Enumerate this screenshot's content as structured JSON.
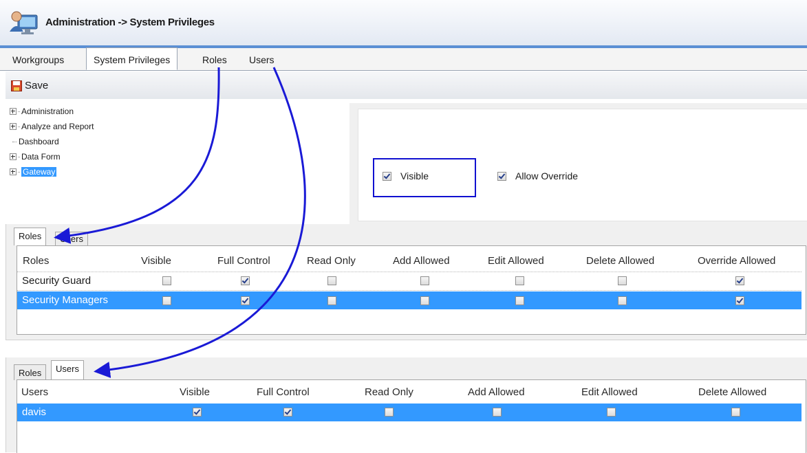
{
  "window": {
    "title": "Administration -> System Privileges"
  },
  "top_tabs": [
    "Workgroups",
    "System Privileges",
    "Roles",
    "Users"
  ],
  "top_tabs_active": "System Privileges",
  "toolbar": {
    "save_label": "Save"
  },
  "tree": {
    "items": [
      {
        "label": "Administration",
        "expandable": true
      },
      {
        "label": "Analyze and Report",
        "expandable": true
      },
      {
        "label": "Dashboard",
        "expandable": false
      },
      {
        "label": "Data Form",
        "expandable": true
      },
      {
        "label": "Gateway",
        "expandable": true,
        "selected": true
      }
    ]
  },
  "privileges": {
    "visible_label": "Visible",
    "visible_checked": true,
    "override_label": "Allow Override",
    "override_checked": true
  },
  "roles_panel": {
    "tabs": [
      "Roles",
      "Users"
    ],
    "active_tab": "Roles",
    "columns": [
      "Roles",
      "Visible",
      "Full Control",
      "Read Only",
      "Add Allowed",
      "Edit Allowed",
      "Delete Allowed",
      "Override Allowed"
    ],
    "rows": [
      {
        "name": "Security Guard",
        "checks": [
          false,
          true,
          false,
          false,
          false,
          false,
          true
        ],
        "selected": false
      },
      {
        "name": "Security Managers",
        "checks": [
          false,
          true,
          false,
          false,
          false,
          false,
          true
        ],
        "selected": true
      }
    ]
  },
  "users_panel": {
    "tabs": [
      "Roles",
      "Users"
    ],
    "active_tab": "Users",
    "columns": [
      "Users",
      "Visible",
      "Full Control",
      "Read Only",
      "Add Allowed",
      "Edit Allowed",
      "Delete Allowed"
    ],
    "rows": [
      {
        "name": "davis",
        "checks": [
          true,
          true,
          false,
          false,
          false,
          false
        ],
        "selected": true
      }
    ]
  },
  "colors": {
    "annotation_arrow": "#1a1ad6",
    "selection": "#3399ff",
    "title_accent": "#5b8fd4"
  },
  "icons": [
    "app-admin-icon",
    "save-disk-icon",
    "tree-expand-icon"
  ]
}
